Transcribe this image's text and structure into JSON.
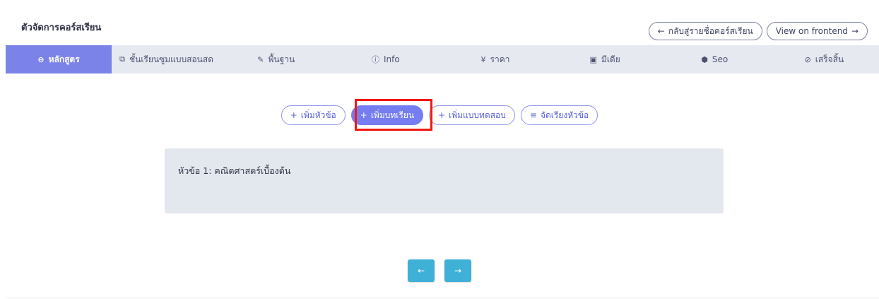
{
  "page": {
    "title": "ตัวจัดการคอร์สเรียน"
  },
  "top_actions": {
    "back": {
      "arrow": "←",
      "label": "กลับสู่รายชื่อคอร์สเรียน"
    },
    "frontend": {
      "label": "View on frontend",
      "arrow": "→"
    }
  },
  "tabs": [
    {
      "icon": "⊖",
      "label": "หลักสูตร",
      "active": true
    },
    {
      "icon": "⧉",
      "label": "ชั้นเรียนซูมแบบสอนสด"
    },
    {
      "icon": "✎",
      "label": "พื้นฐาน"
    },
    {
      "icon": "ⓘ",
      "label": "Info"
    },
    {
      "icon": "¥",
      "label": "ราคา"
    },
    {
      "icon": "▣",
      "label": "มีเดีย"
    },
    {
      "icon": "⬢",
      "label": "Seo"
    },
    {
      "icon": "⊘",
      "label": "เสร็จสิ้น"
    }
  ],
  "toolbar": {
    "add_topic": {
      "icon": "+",
      "label": "เพิ่มหัวข้อ"
    },
    "add_lesson": {
      "icon": "+",
      "label": "เพิ่มบทเรียน"
    },
    "add_quiz": {
      "icon": "+",
      "label": "เพิ่มแบบทดสอบ"
    },
    "sort_topics": {
      "icon": "≡",
      "label": "จัดเรียงหัวข้อ"
    }
  },
  "section": {
    "title": "หัวข้อ 1: คณิตศาสตร์เบื้องต้น"
  },
  "nav": {
    "prev_icon": "←",
    "next_icon": "→"
  },
  "colors": {
    "accent": "#757df0",
    "tab_bar": "#e6e9f0",
    "section_bg": "#e3e8ee",
    "nav_button": "#3fb1d7",
    "highlight": "#f2180f"
  }
}
